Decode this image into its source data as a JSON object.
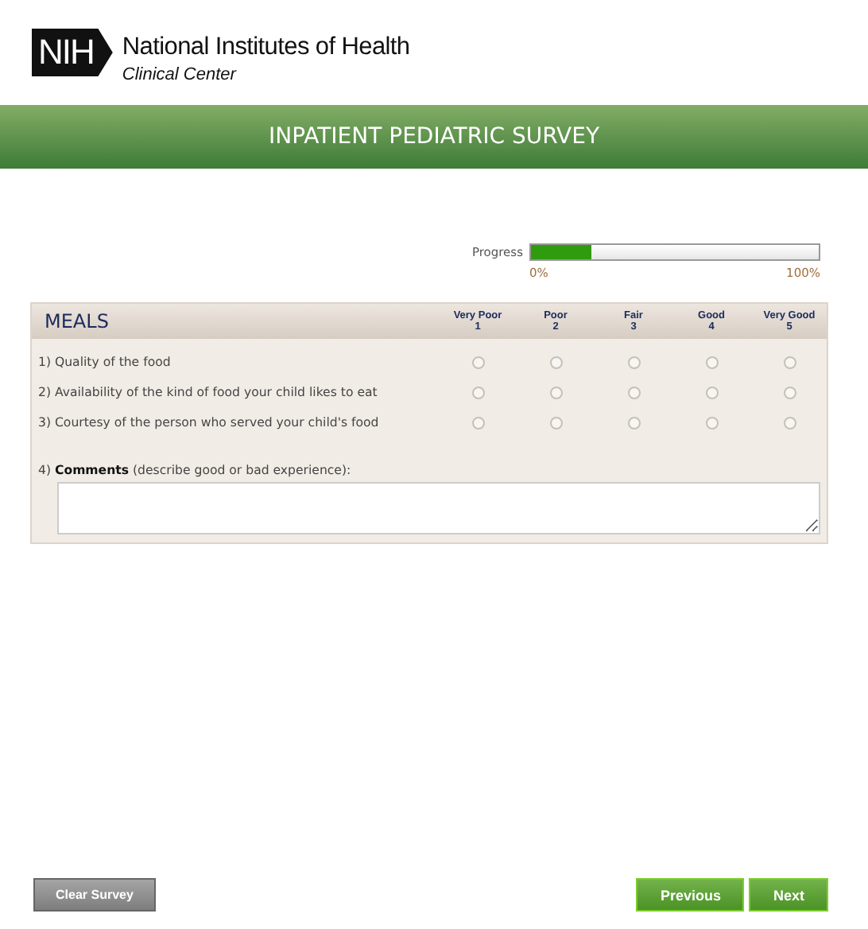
{
  "logo": {
    "mark": "NIH",
    "name": "National Institutes of Health",
    "subtitle": "Clinical Center"
  },
  "banner": {
    "title": "INPATIENT PEDIATRIC SURVEY"
  },
  "progress": {
    "label": "Progress",
    "level": 0.21,
    "min_label": "0%",
    "max_label": "100%"
  },
  "section": {
    "title": "MEALS",
    "columns": [
      {
        "label": "Very Poor",
        "number": "1"
      },
      {
        "label": "Poor",
        "number": "2"
      },
      {
        "label": "Fair",
        "number": "3"
      },
      {
        "label": "Good",
        "number": "4"
      },
      {
        "label": "Very Good",
        "number": "5"
      }
    ],
    "questions": [
      {
        "text": "1) Quality of the food",
        "ratings": [
          {
            "selected": false
          },
          {
            "selected": false
          },
          {
            "selected": false
          },
          {
            "selected": false
          },
          {
            "selected": false
          }
        ]
      },
      {
        "text": "2) Availability of the kind of food your child likes to eat",
        "ratings": [
          {
            "selected": false
          },
          {
            "selected": false
          },
          {
            "selected": false
          },
          {
            "selected": false
          },
          {
            "selected": false
          }
        ]
      },
      {
        "text": "3) Courtesy of the person who served your child's food",
        "ratings": [
          {
            "selected": false
          },
          {
            "selected": false
          },
          {
            "selected": false
          },
          {
            "selected": false
          },
          {
            "selected": false
          }
        ]
      }
    ],
    "comments": {
      "prompt": "4) **Comments** (describe good or bad experience):"
    }
  },
  "buttons": [
    {
      "label": "Clear Survey",
      "kind": "secondary"
    },
    {
      "label": "Previous",
      "kind": "primary"
    },
    {
      "label": "Next",
      "kind": "primary"
    }
  ]
}
